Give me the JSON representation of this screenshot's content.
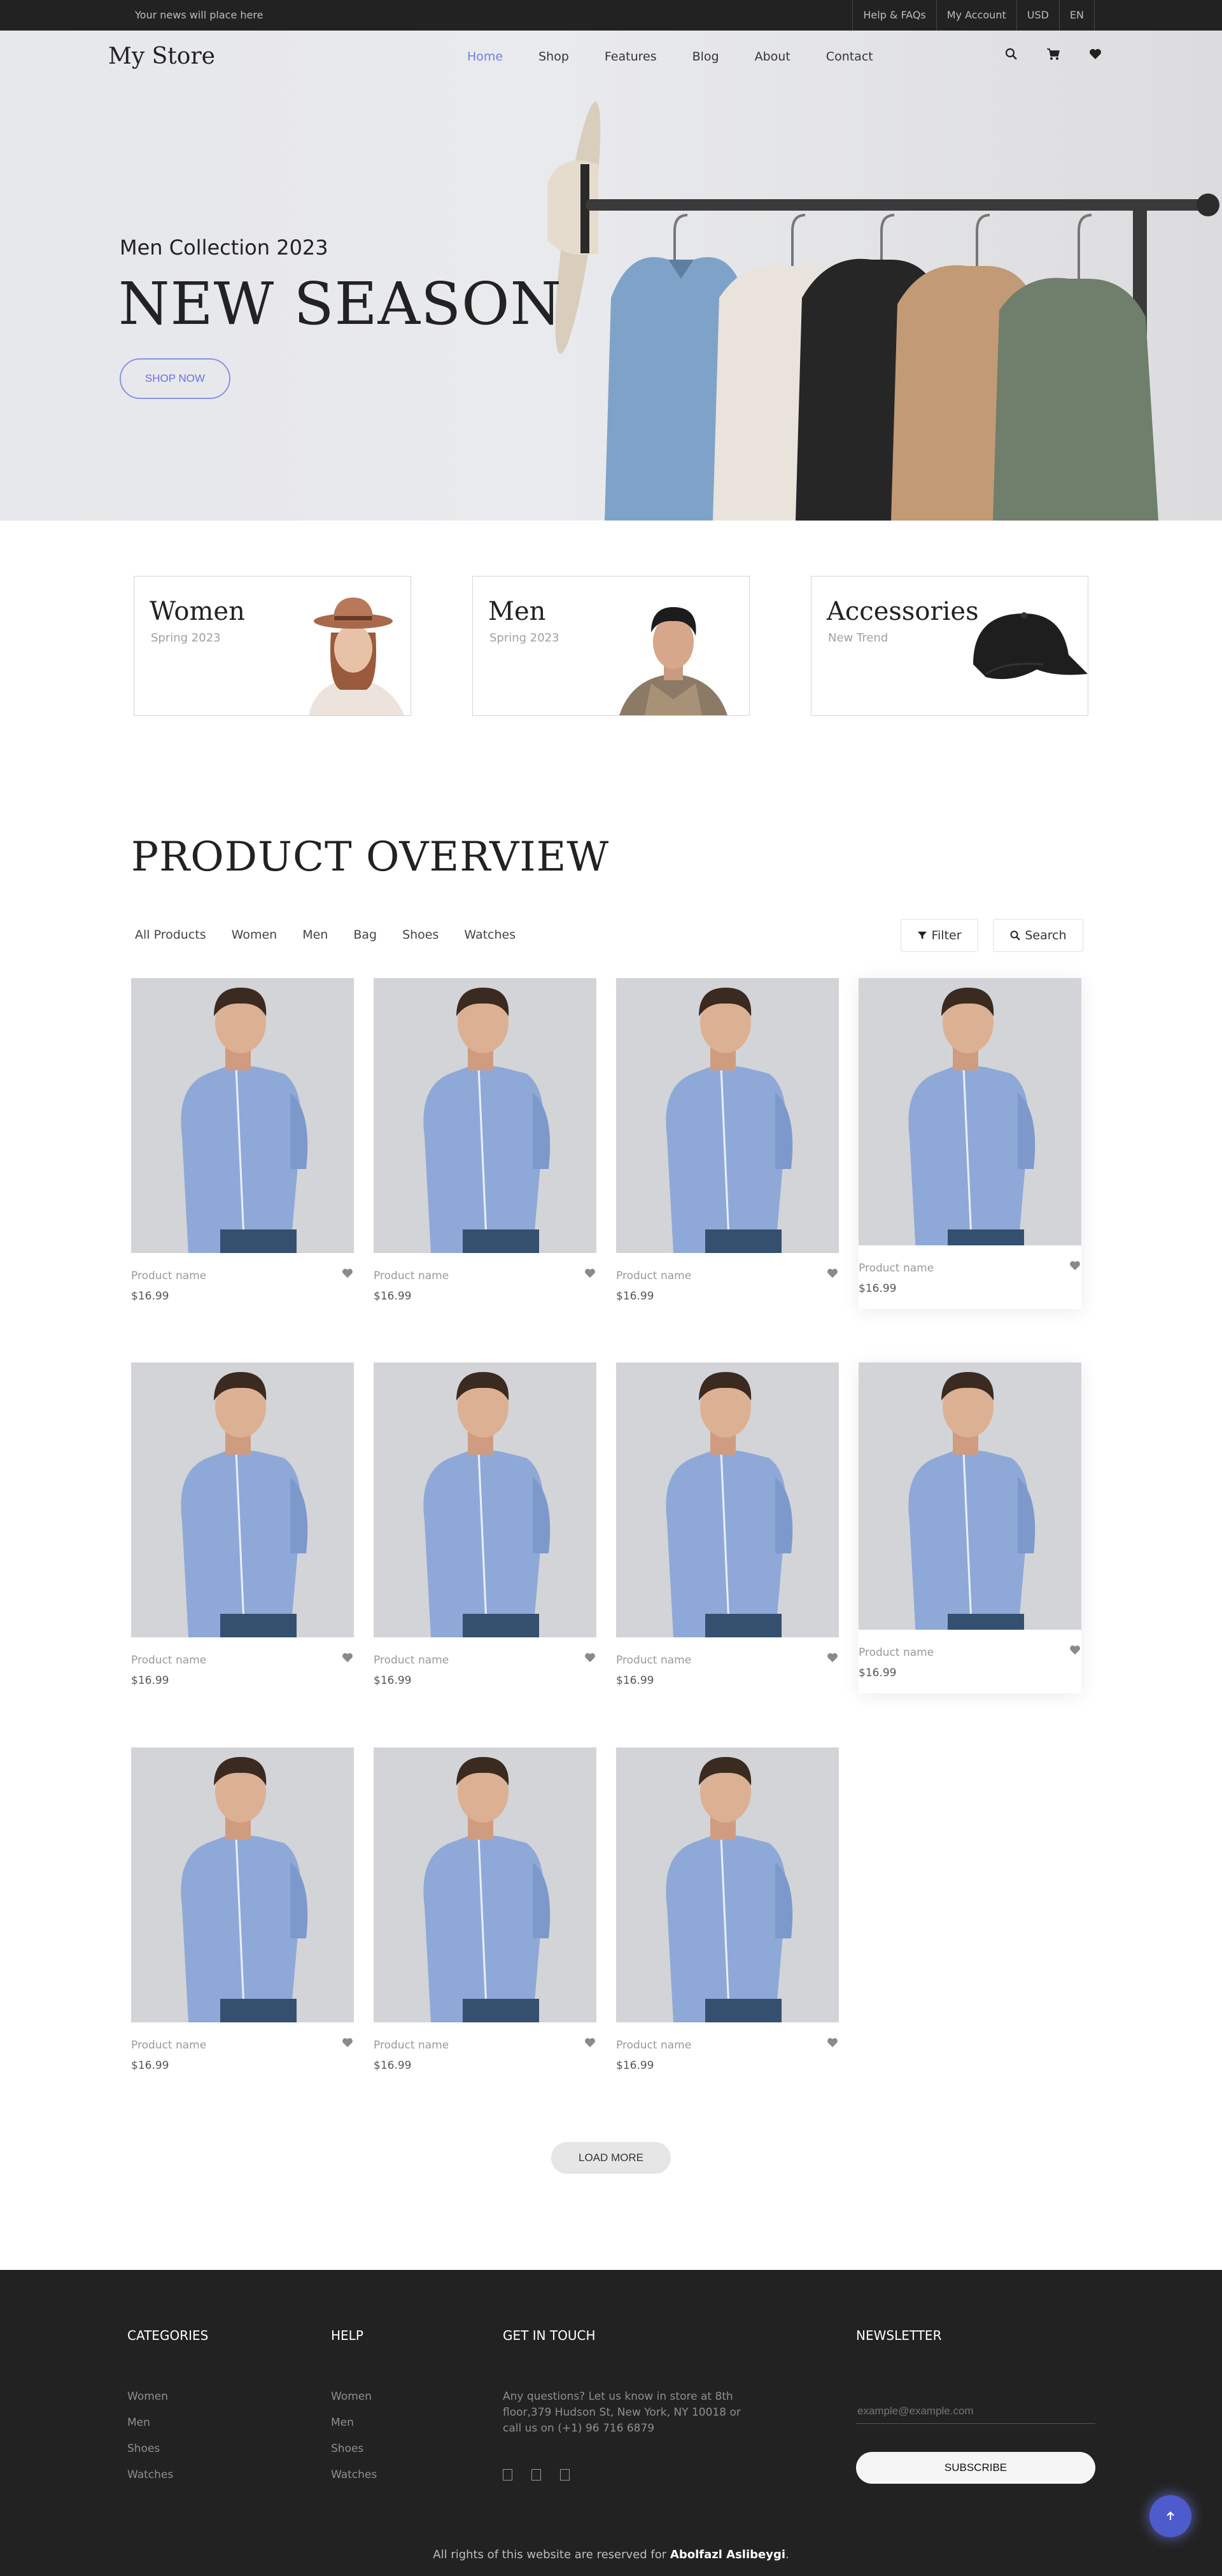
{
  "topbar": {
    "news": "Your news will place here",
    "links": [
      "Help & FAQs",
      "My Account",
      "USD",
      "EN"
    ]
  },
  "header": {
    "logo": "My Store",
    "nav": [
      "Home",
      "Shop",
      "Features",
      "Blog",
      "About",
      "Contact"
    ],
    "active": "Home",
    "icons": [
      "search-icon",
      "cart-icon",
      "heart-icon"
    ]
  },
  "hero": {
    "subtitle": "Men Collection 2023",
    "title": "NEW SEASON",
    "button": "SHOP NOW"
  },
  "categories": [
    {
      "title": "Women",
      "subtitle": "Spring 2023"
    },
    {
      "title": "Men",
      "subtitle": "Spring 2023"
    },
    {
      "title": "Accessories",
      "subtitle": "New Trend"
    }
  ],
  "overview": {
    "title": "PRODUCT OVERVIEW",
    "filters": [
      "All Products",
      "Women",
      "Men",
      "Bag",
      "Shoes",
      "Watches"
    ],
    "filter_button": "Filter",
    "search_button": "Search",
    "products": [
      {
        "name": "Product name",
        "price": "$16.99"
      },
      {
        "name": "Product name",
        "price": "$16.99"
      },
      {
        "name": "Product name",
        "price": "$16.99"
      },
      {
        "name": "Product name",
        "price": "$16.99"
      },
      {
        "name": "Product name",
        "price": "$16.99"
      },
      {
        "name": "Product name",
        "price": "$16.99"
      },
      {
        "name": "Product name",
        "price": "$16.99"
      },
      {
        "name": "Product name",
        "price": "$16.99"
      },
      {
        "name": "Product name",
        "price": "$16.99"
      },
      {
        "name": "Product name",
        "price": "$16.99"
      },
      {
        "name": "Product name",
        "price": "$16.99"
      }
    ],
    "load_more": "LOAD MORE"
  },
  "footer": {
    "categories_title": "CATEGORIES",
    "categories": [
      "Women",
      "Men",
      "Shoes",
      "Watches"
    ],
    "help_title": "HELP",
    "help": [
      "Women",
      "Men",
      "Shoes",
      "Watches"
    ],
    "contact_title": "GET IN TOUCH",
    "contact_text": "Any questions? Let us know in store at 8th floor,379 Hudson St, New York, NY 10018 or call us on (+1) 96 716 6879",
    "newsletter_title": "NEWSLETTER",
    "email_placeholder": "example@example.com",
    "subscribe": "SUBSCRIBE",
    "copyright": "All rights of this website are reserved for",
    "author": "Abolfazl Aslibeygi",
    "copyright_end": "."
  },
  "colors": {
    "accent": "#717fe0",
    "dark": "#222222",
    "to_top": "#4e5bcc"
  }
}
